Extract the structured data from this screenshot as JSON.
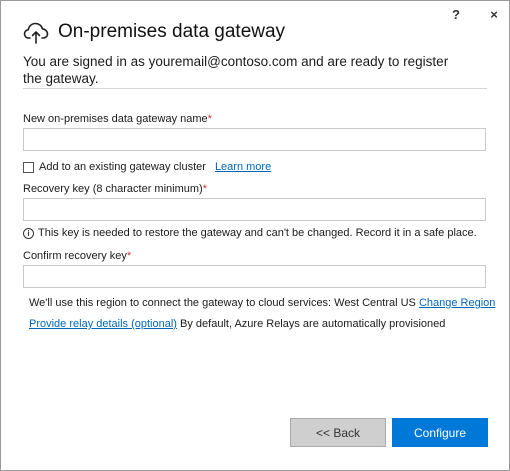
{
  "window": {
    "help_label": "?",
    "close_label": "×"
  },
  "header": {
    "title": "On-premises data gateway",
    "icon": "cloud-upload-icon"
  },
  "signed_in_text": "You are signed in as youremail@contoso.com and are ready to register the gateway.",
  "form": {
    "gateway_name": {
      "label": "New on-premises data gateway name",
      "required_marker": "*",
      "value": ""
    },
    "existing_cluster": {
      "label": "Add to an existing gateway cluster",
      "checked": false,
      "learn_more": "Learn more"
    },
    "recovery_key": {
      "label": "Recovery key (8 character minimum)",
      "required_marker": "*",
      "value": ""
    },
    "info_text": "This key is needed to restore the gateway and can't be changed. Record it in a safe place.",
    "confirm_recovery_key": {
      "label": "Confirm recovery key",
      "required_marker": "*",
      "value": ""
    }
  },
  "region": {
    "text": "We'll use this region to connect the gateway to cloud services: West Central US",
    "change_link": "Change Region"
  },
  "relay": {
    "link": "Provide relay details (optional)",
    "text": "By default, Azure Relays are automatically provisioned"
  },
  "buttons": {
    "back": "<< Back",
    "configure": "Configure"
  },
  "colors": {
    "accent": "#0078d7",
    "link": "#0067b8",
    "required": "#d13438",
    "back_button_bg": "#cfcfcf"
  }
}
